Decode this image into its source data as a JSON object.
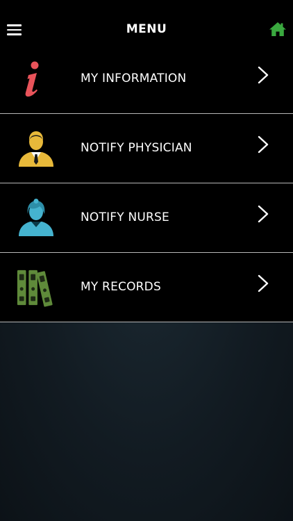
{
  "header": {
    "title": "MENU",
    "menu_icon": "hamburger-icon",
    "home_icon": "home-icon",
    "home_icon_color": "#3aa93f"
  },
  "menu": {
    "items": [
      {
        "label": "MY INFORMATION",
        "icon": "info-icon",
        "icon_color": "#e8535a"
      },
      {
        "label": "NOTIFY PHYSICIAN",
        "icon": "physician-icon",
        "icon_color": "#e8b93a"
      },
      {
        "label": "NOTIFY NURSE",
        "icon": "nurse-icon",
        "icon_color": "#45b3cf"
      },
      {
        "label": "MY RECORDS",
        "icon": "records-binders-icon",
        "icon_color": "#5f8a3a"
      }
    ]
  },
  "colors": {
    "header_bg": "#000000",
    "item_bg": "#000000",
    "divider": "#b8b8b8",
    "text": "#ffffff"
  }
}
